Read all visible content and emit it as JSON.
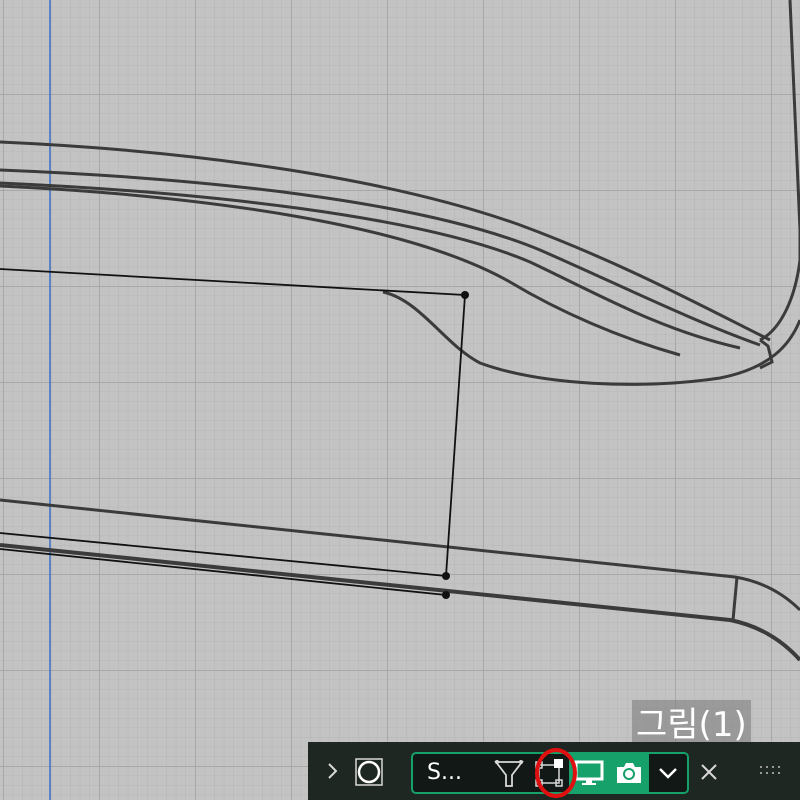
{
  "viewport": {
    "background": "#c3c3c3",
    "grid_color": "#a7a7a7",
    "curve_color": "#3b3b3b",
    "axis_color": "#3a6fc4"
  },
  "figure_label": "그림(1)",
  "toolbar": {
    "background": "#1f2722",
    "accent": "#16a06a",
    "expand_icon": "chevron-right-icon",
    "circle_tool_icon": "circle-in-square-icon",
    "shape_select_value": "S...",
    "filter_icon": "filter-funnel-icon",
    "select_transform_icon": "transform-box-icon",
    "display_icon": "monitor-icon",
    "snapshot_icon": "camera-icon",
    "dropdown_icon": "chevron-down-icon",
    "close_icon": "close-icon",
    "grip_icon": "grip-dots-icon",
    "highlight_color": "#e01010"
  }
}
